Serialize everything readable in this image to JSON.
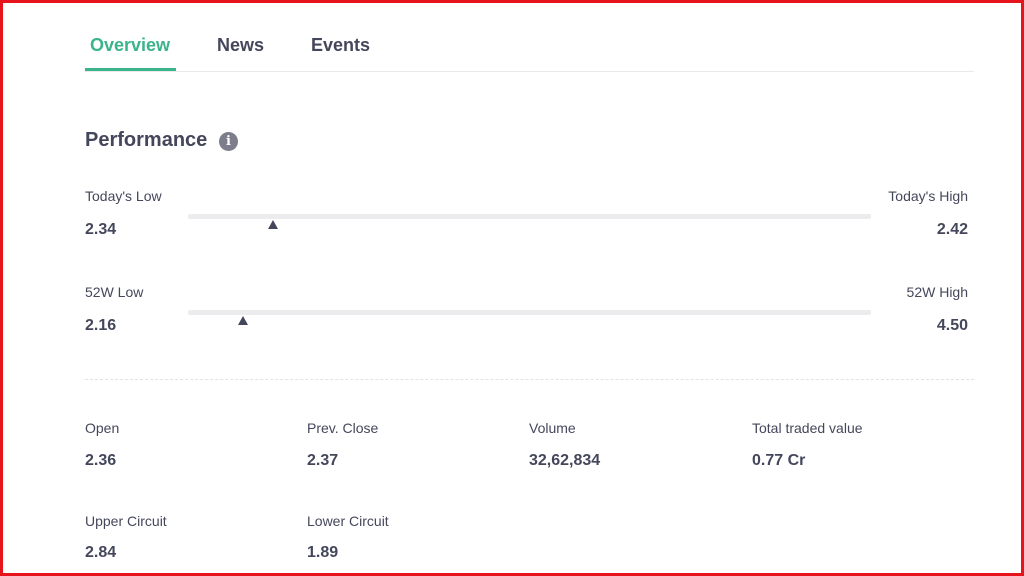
{
  "tabs": [
    {
      "label": "Overview",
      "active": true
    },
    {
      "label": "News",
      "active": false
    },
    {
      "label": "Events",
      "active": false
    }
  ],
  "performance": {
    "title": "Performance",
    "info_icon": "info-icon",
    "ranges": [
      {
        "low_label": "Today's Low",
        "low_value": "2.34",
        "high_label": "Today's High",
        "high_value": "2.42",
        "marker_fraction": 0.125
      },
      {
        "low_label": "52W Low",
        "low_value": "2.16",
        "high_label": "52W High",
        "high_value": "4.50",
        "marker_fraction": 0.08
      }
    ],
    "stats": [
      {
        "label": "Open",
        "value": "2.36"
      },
      {
        "label": "Prev. Close",
        "value": "2.37"
      },
      {
        "label": "Volume",
        "value": "32,62,834"
      },
      {
        "label": "Total traded value",
        "value": "0.77 Cr"
      },
      {
        "label": "Upper Circuit",
        "value": "2.84"
      },
      {
        "label": "Lower Circuit",
        "value": "1.89"
      }
    ]
  },
  "colors": {
    "accent": "#3bb38b",
    "text": "#44475b",
    "border": "#e8141c"
  }
}
